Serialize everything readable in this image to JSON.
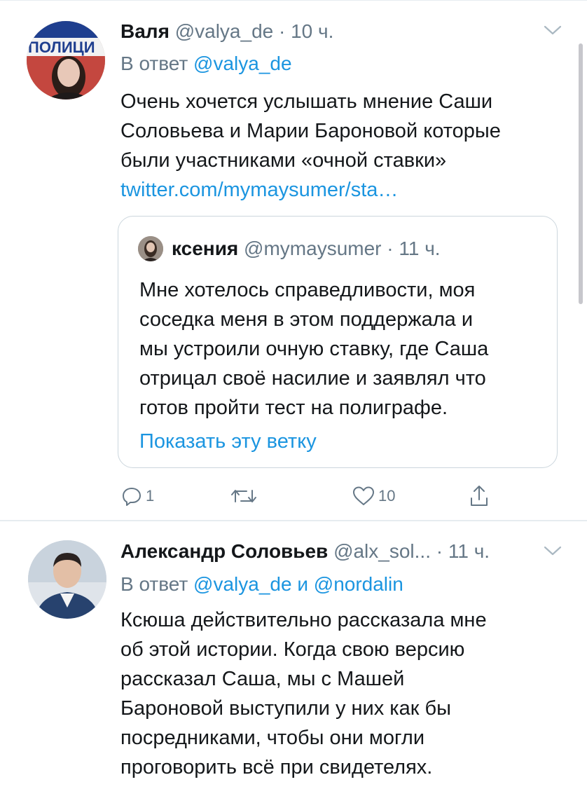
{
  "tweets": [
    {
      "display_name": "Валя",
      "handle": "@valya_de",
      "separator": "·",
      "time": "10 ч.",
      "reply_prefix": "В ответ",
      "reply_handles": [
        "@valya_de"
      ],
      "text_lines": [
        "Очень хочется услышать мнение Саши",
        "Соловьева и Марии Бароновой которые",
        "были участниками «очной ставки»",
        "twitter.com/mymaysumer/sta…"
      ],
      "avatar_sign_text": "ПОЛИЦИ",
      "quote": {
        "display_name": "ксения",
        "handle": "@mymaysumer",
        "separator": "·",
        "time": "11 ч.",
        "text_lines": [
          "Мне хотелось справедливости, моя",
          "соседка меня в этом поддержала и",
          "мы устроили очную ставку, где Саша",
          "отрицал своё насилие и заявлял что",
          "готов пройти тест на полиграфе."
        ],
        "show_thread": "Показать эту ветку"
      },
      "actions": {
        "reply_count": "1",
        "retweet_count": "",
        "like_count": "10"
      }
    },
    {
      "display_name": "Александр Соловьев",
      "handle": "@alx_sol...",
      "separator": "·",
      "time": "11 ч.",
      "reply_prefix": "В ответ",
      "reply_handles": [
        "@valya_de",
        "@nordalin"
      ],
      "reply_joiner": "и",
      "text_lines": [
        "Ксюша действительно рассказала мне",
        "об этой истории. Когда свою версию",
        "рассказал Саша, мы с Машей",
        "Бароновой выступили у них как бы",
        "посредниками, чтобы они могли",
        "проговорить всё при свидетелях."
      ]
    }
  ],
  "icons": {
    "reply": "reply-icon",
    "retweet": "retweet-icon",
    "like": "like-icon",
    "share": "share-icon",
    "chevron": "chevron-down-icon"
  },
  "colors": {
    "link": "#1b95e0",
    "secondary_text": "#657786",
    "primary_text": "#14171a",
    "divider": "#e6ecf0"
  }
}
